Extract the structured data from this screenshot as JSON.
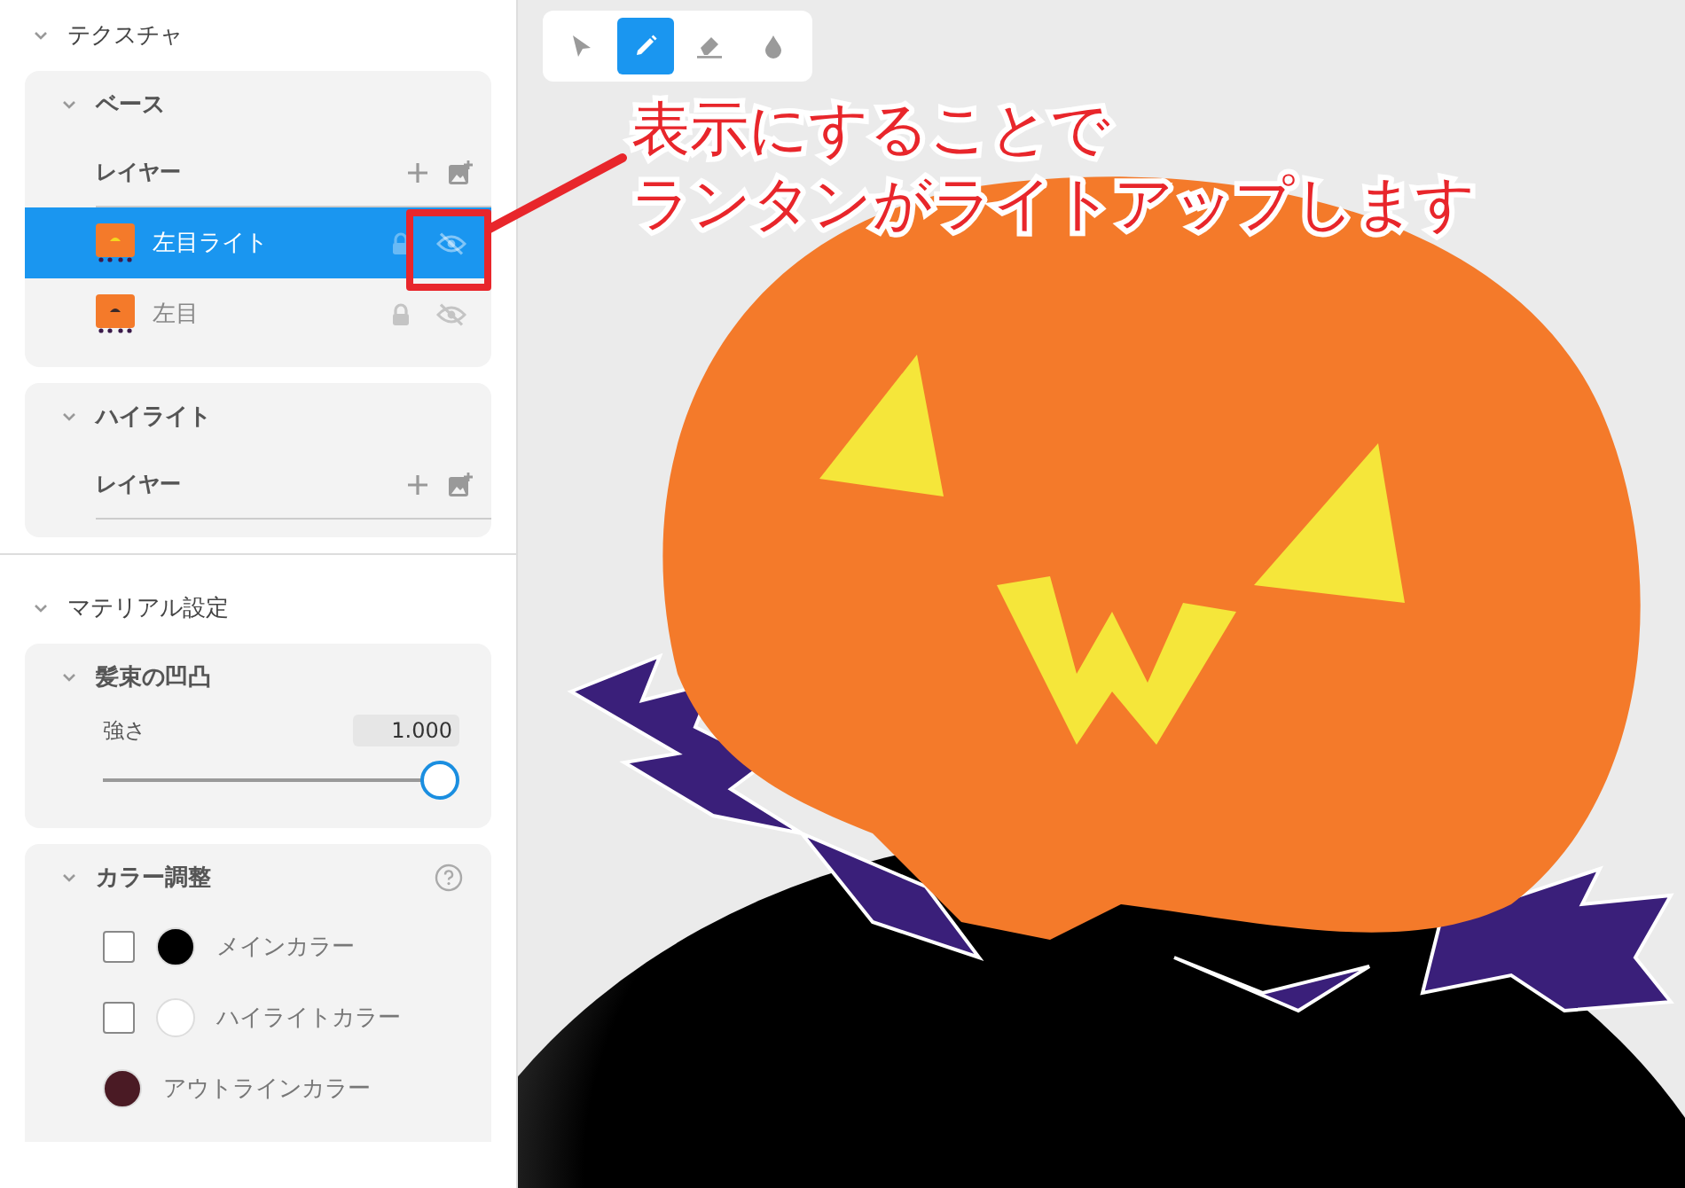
{
  "texture": {
    "title": "テクスチャ",
    "expanded": true,
    "groups": [
      {
        "title": "ベース",
        "expanded": true,
        "layers_label": "レイヤー",
        "layers": [
          {
            "name": "左目ライト",
            "selected": true,
            "hidden": true
          },
          {
            "name": "左目",
            "selected": false,
            "hidden": true
          }
        ]
      },
      {
        "title": "ハイライト",
        "expanded": true,
        "layers_label": "レイヤー"
      }
    ]
  },
  "material": {
    "title": "マテリアル設定",
    "expanded": true,
    "bump": {
      "title": "髪束の凹凸",
      "expanded": true,
      "slider": {
        "label": "強さ",
        "value": "1.000",
        "level": 1.0
      }
    },
    "color_adjust": {
      "title": "カラー調整",
      "expanded": true,
      "colors": [
        {
          "kind": "checkbox",
          "label": "メインカラー",
          "checked": false,
          "color": "#000000"
        },
        {
          "kind": "checkbox",
          "label": "ハイライトカラー",
          "checked": false,
          "color": "#ffffff"
        },
        {
          "kind": "plain",
          "label": "アウトラインカラー",
          "color": "#4a1a24"
        }
      ]
    }
  },
  "toolbar": [
    {
      "kind": "pointer",
      "selected": false
    },
    {
      "kind": "pen",
      "selected": true
    },
    {
      "kind": "eraser",
      "selected": false
    },
    {
      "kind": "dropper",
      "selected": false
    }
  ],
  "annotation": {
    "lines": [
      "表示にすることで",
      "ランタンがライトアップします"
    ]
  }
}
